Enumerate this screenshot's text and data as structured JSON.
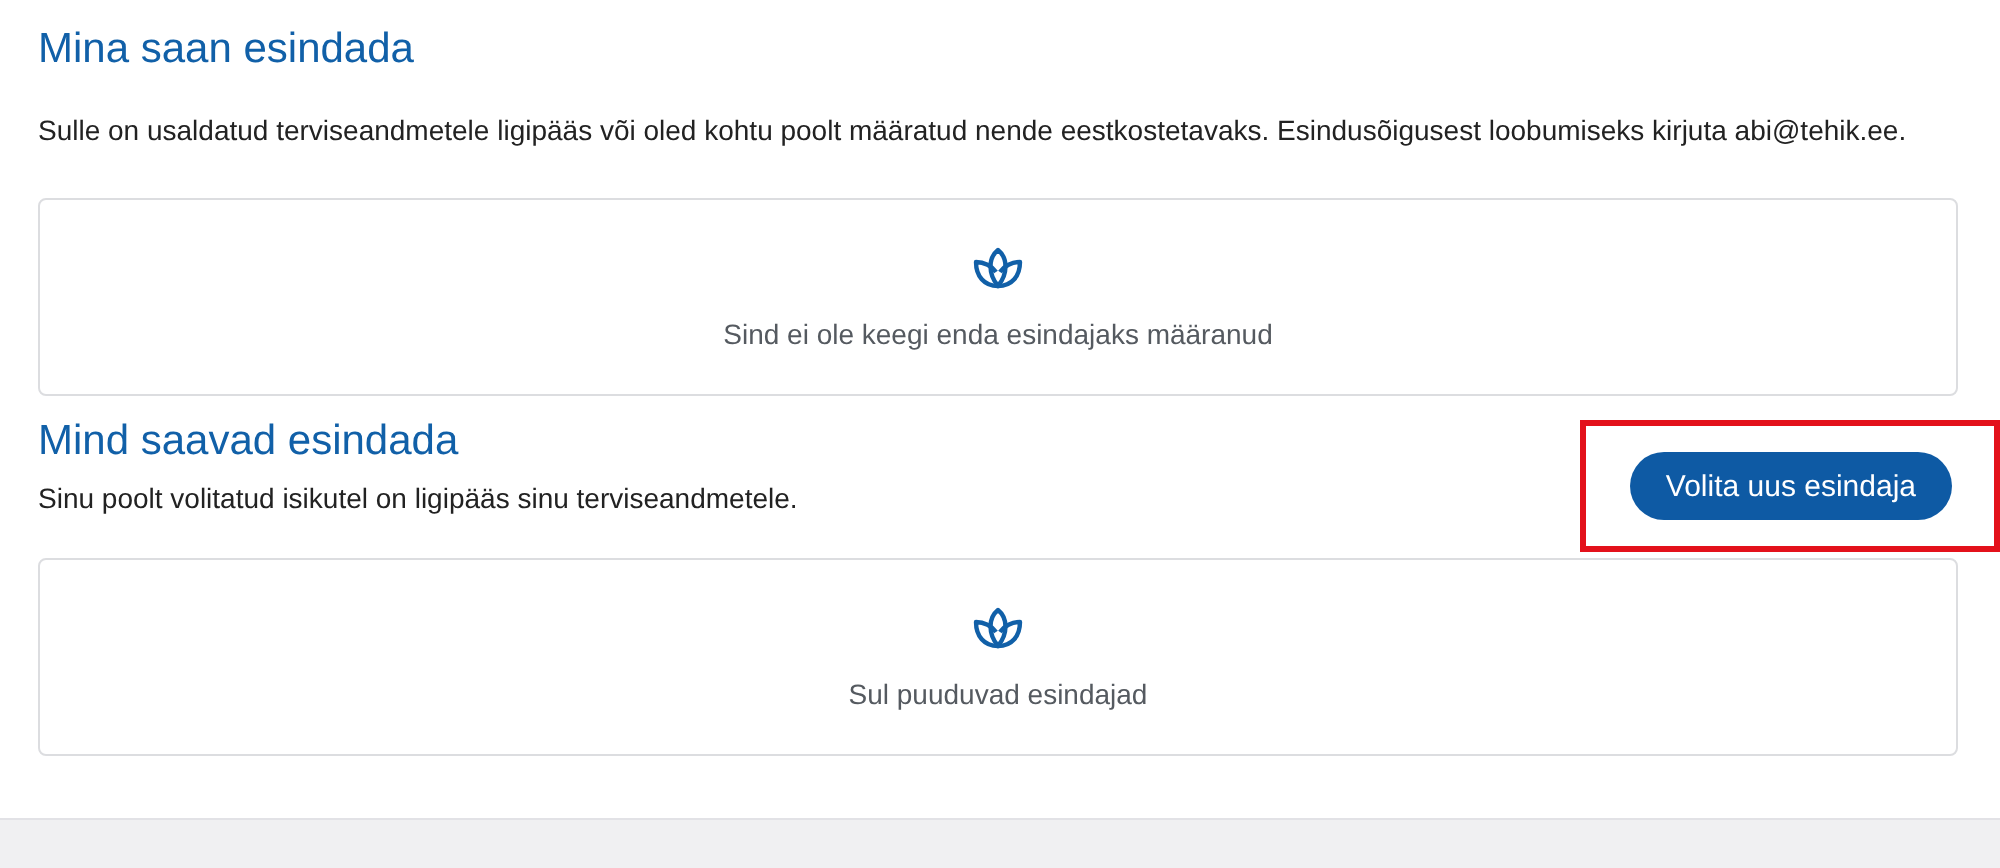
{
  "sections": [
    {
      "title": "Mina saan esindada",
      "description": "Sulle on usaldatud terviseandmetele ligipääs või oled kohtu poolt määratud nende eestkostetavaks. Esindusõigusest loobumiseks kirjuta abi@tehik.ee.",
      "empty_message": "Sind ei ole keegi enda esindajaks määranud"
    },
    {
      "title": "Mind saavad esindada",
      "description": "Sinu poolt volitatud isikutel on ligipääs sinu terviseandmetele.",
      "button": {
        "label": "Volita uus esindaja",
        "highlighted": true
      },
      "empty_message": "Sul puuduvad esindajad"
    }
  ]
}
